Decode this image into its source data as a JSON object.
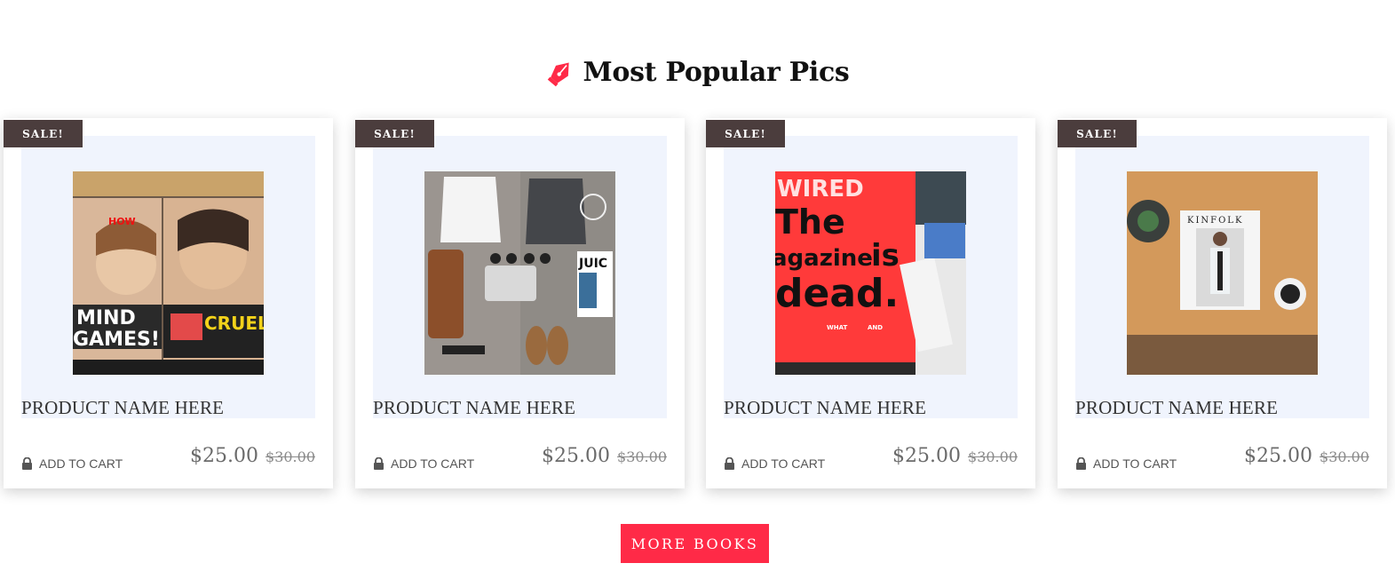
{
  "section": {
    "title": "Most Popular Pics",
    "icon": "pen-nib-icon",
    "accent_color": "#ff2a47"
  },
  "products": [
    {
      "badge": "SALE!",
      "name": "PRODUCT NAME HERE",
      "add_to_cart": "ADD TO CART",
      "price": "$25.00",
      "old_price": "$30.00",
      "image": "magazine-rack"
    },
    {
      "badge": "SALE!",
      "name": "PRODUCT NAME HERE",
      "add_to_cart": "ADD TO CART",
      "price": "$25.00",
      "old_price": "$30.00",
      "image": "flat-lay-outfit"
    },
    {
      "badge": "SALE!",
      "name": "PRODUCT NAME HERE",
      "add_to_cart": "ADD TO CART",
      "price": "$25.00",
      "old_price": "$30.00",
      "image": "wired-magazine"
    },
    {
      "badge": "SALE!",
      "name": "PRODUCT NAME HERE",
      "add_to_cart": "ADD TO CART",
      "price": "$25.00",
      "old_price": "$30.00",
      "image": "kinfolk-magazine"
    }
  ],
  "more_button": "MORE BOOKS",
  "colors": {
    "badge_bg": "#4b3d3d",
    "image_panel_bg": "#f0f4fd",
    "button_bg": "#ff2a47"
  }
}
